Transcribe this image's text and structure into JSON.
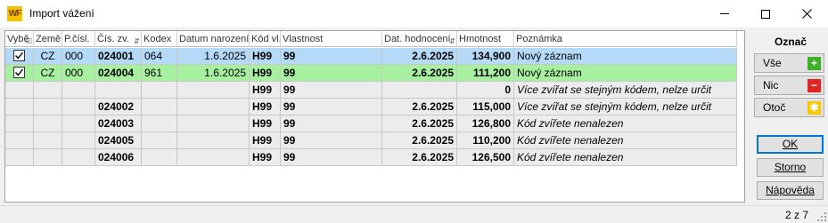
{
  "window": {
    "title": "Import vážení",
    "logo_text": "WF"
  },
  "grid": {
    "columns": [
      "Vybě",
      "Země",
      "P.čísl.",
      "Čís. zv.",
      "Kodex",
      "Datum narození",
      "Kód vl.",
      "Vlastnost",
      "Dat. hodnocení",
      "Hmotnost",
      "Poznámka"
    ],
    "rows": [
      {
        "checked": true,
        "zeme": "CZ",
        "pcisl": "000",
        "ciszv": "024001",
        "kodex": "064",
        "datum": "1.6.2025",
        "kodvl": "H99",
        "vlastnost": "99",
        "dathod": "2.6.2025",
        "hmotnost": "134,900",
        "poznamka": "Nový záznam"
      },
      {
        "checked": true,
        "zeme": "CZ",
        "pcisl": "000",
        "ciszv": "024004",
        "kodex": "961",
        "datum": "1.6.2025",
        "kodvl": "H99",
        "vlastnost": "99",
        "dathod": "2.6.2025",
        "hmotnost": "111,200",
        "poznamka": "Nový záznam"
      },
      {
        "checked": false,
        "zeme": "",
        "pcisl": "",
        "ciszv": "",
        "kodex": "",
        "datum": "",
        "kodvl": "H99",
        "vlastnost": "99",
        "dathod": "",
        "hmotnost": "0",
        "poznamka": "Více zvířat se stejným kódem, nelze určit"
      },
      {
        "checked": false,
        "zeme": "",
        "pcisl": "",
        "ciszv": "024002",
        "kodex": "",
        "datum": "",
        "kodvl": "H99",
        "vlastnost": "99",
        "dathod": "2.6.2025",
        "hmotnost": "115,000",
        "poznamka": "Více zvířat se stejným kódem, nelze určit"
      },
      {
        "checked": false,
        "zeme": "",
        "pcisl": "",
        "ciszv": "024003",
        "kodex": "",
        "datum": "",
        "kodvl": "H99",
        "vlastnost": "99",
        "dathod": "2.6.2025",
        "hmotnost": "126,800",
        "poznamka": "Kód zvířete nenalezen"
      },
      {
        "checked": false,
        "zeme": "",
        "pcisl": "",
        "ciszv": "024005",
        "kodex": "",
        "datum": "",
        "kodvl": "H99",
        "vlastnost": "99",
        "dathod": "2.6.2025",
        "hmotnost": "110,200",
        "poznamka": "Kód zvířete nenalezen"
      },
      {
        "checked": false,
        "zeme": "",
        "pcisl": "",
        "ciszv": "024006",
        "kodex": "",
        "datum": "",
        "kodvl": "H99",
        "vlastnost": "99",
        "dathod": "2.6.2025",
        "hmotnost": "126,500",
        "poznamka": "Kód zvířete nenalezen"
      }
    ]
  },
  "panel": {
    "title": "Označ",
    "all_label": "Vše",
    "none_label": "Nic",
    "invert_label": "Otoč",
    "ok_label": "OK",
    "cancel_label": "Storno",
    "help_label": "Nápověda"
  },
  "status": {
    "count": "2 z 7"
  },
  "colors": {
    "row_selected_blue": "#b5daf7",
    "row_selected_green": "#a6f0a0",
    "row_unmatched": "#ececec",
    "plus_badge": "#3fae2a",
    "minus_badge": "#e02525",
    "star_badge": "#f7c800",
    "default_button_border": "#0078d7"
  },
  "icons": {
    "logo": "wf-logo-icon",
    "minimize": "minimize-icon",
    "maximize": "maximize-icon",
    "close": "close-icon",
    "select_all": "plus-icon",
    "select_none": "minus-icon",
    "invert": "star-icon",
    "checkbox": "checkbox-icon",
    "sort": "sort-indicator-icon",
    "size_grip": "size-grip-icon"
  }
}
